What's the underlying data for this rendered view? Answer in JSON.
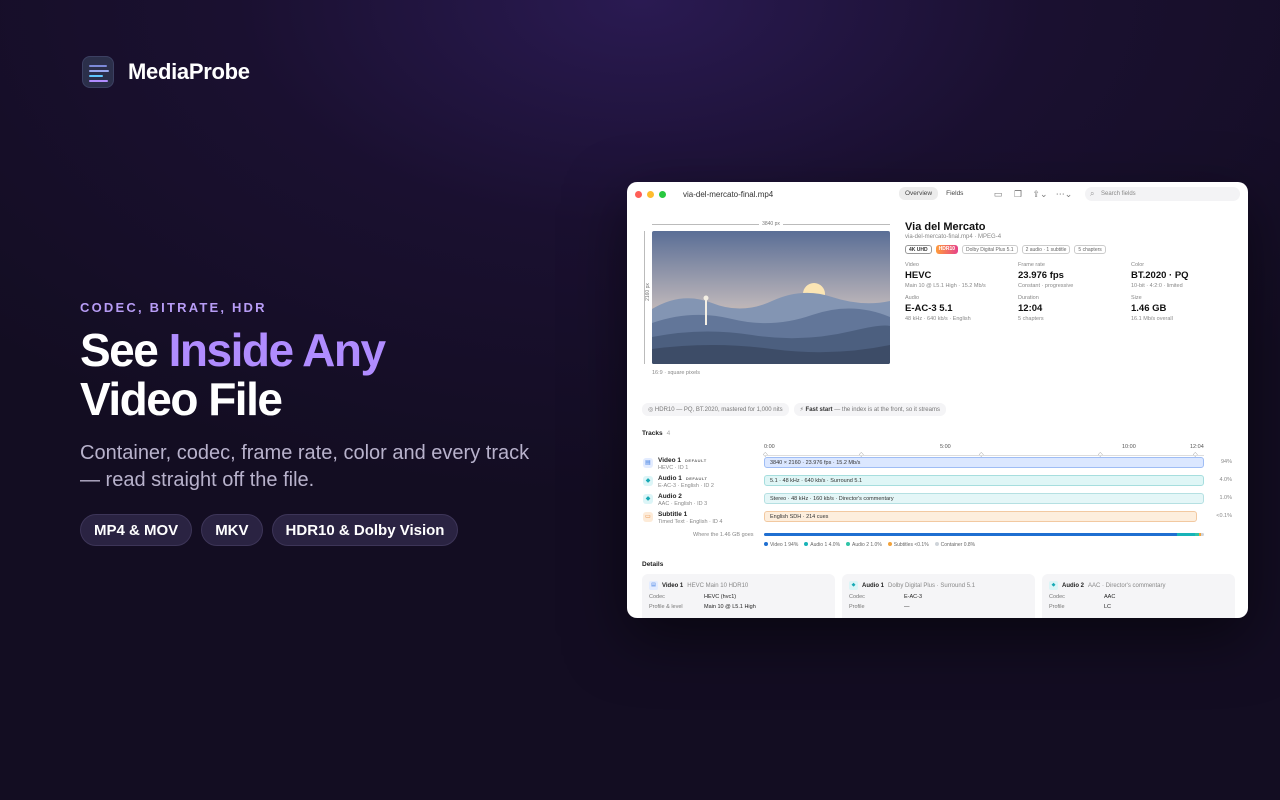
{
  "brand": {
    "name": "MediaProbe"
  },
  "hero": {
    "eyebrow": "CODEC, BITRATE, HDR",
    "headline_1": "See ",
    "headline_accent": "Inside Any",
    "headline_2": "Video File",
    "subtitle": "Container, codec, frame rate, color and every track — read straight off the file.",
    "pills": [
      "MP4 & MOV",
      "MKV",
      "HDR10 & Dolby Vision"
    ]
  },
  "window": {
    "filename": "via-del-mercato-final.mp4",
    "tabs": [
      {
        "label": "Overview",
        "active": true
      },
      {
        "label": "Fields",
        "active": false
      }
    ],
    "search_placeholder": "Search fields",
    "preview": {
      "width_label": "3840 px",
      "height_label": "2160 px",
      "aspect": "16:9 · square pixels"
    },
    "title": "Via del Mercato",
    "subtitle": "via-del-mercato-final.mp4 · MPEG-4",
    "badges": [
      "4K UHD",
      "HDR10",
      "Dolby Digital Plus 5.1",
      "2 audio · 1 subtitle",
      "5 chapters"
    ],
    "stats": [
      {
        "label": "Video",
        "value": "HEVC",
        "detail": "Main 10 @ L5.1 High · 15.2 Mb/s"
      },
      {
        "label": "Frame rate",
        "value": "23.976 fps",
        "detail": "Constant · progressive"
      },
      {
        "label": "Color",
        "value": "BT.2020 · PQ",
        "detail": "10-bit · 4:2:0 · limited"
      },
      {
        "label": "Audio",
        "value": "E-AC-3 5.1",
        "detail": "48 kHz · 640 kb/s · English"
      },
      {
        "label": "Duration",
        "value": "12:04",
        "detail": "5 chapters"
      },
      {
        "label": "Size",
        "value": "1.46 GB",
        "detail": "16.1 Mb/s overall"
      }
    ],
    "chips": [
      {
        "icon": "◎",
        "bold": "",
        "text": "HDR10 — PQ, BT.2020, mastered for 1,000 nits"
      },
      {
        "icon": "⚡",
        "bold": "Fast start",
        "text": " — the index is at the front, so it streams"
      }
    ],
    "tracks_label": "Tracks",
    "tracks_count": "4",
    "timeline": [
      "0:00",
      "5:00",
      "10:00",
      "12:04"
    ],
    "tracks": [
      {
        "name": "Video 1",
        "tag": "DEFAULT",
        "meta": "HEVC · ID 1",
        "bar": "3840 × 2160 · 23.976 fps · 15.2 Mb/s",
        "pct": "94%",
        "icon": "▤",
        "color": "#dbe7ff",
        "border": "#9fbdf5",
        "icolor": "#3b7be0",
        "ibg": "#e3ecff",
        "barwidth": 440
      },
      {
        "name": "Audio 1",
        "tag": "DEFAULT",
        "meta": "E-AC-3 · English · ID 2",
        "bar": "5.1 · 48 kHz · 640 kb/s · Surround 5.1",
        "pct": "4.0%",
        "icon": "◆",
        "color": "#dff6f6",
        "border": "#a6dede",
        "icolor": "#17a9b5",
        "ibg": "#dcf5f7",
        "barwidth": 440
      },
      {
        "name": "Audio 2",
        "tag": "",
        "meta": "AAC · English · ID 3",
        "bar": "Stereo · 48 kHz · 160 kb/s · Director's commentary",
        "pct": "1.0%",
        "icon": "◆",
        "color": "#e4f6f7",
        "border": "#b5e0e2",
        "icolor": "#17a9b5",
        "ibg": "#dcf5f7",
        "barwidth": 440
      },
      {
        "name": "Subtitle 1",
        "tag": "",
        "meta": "Timed Text · English · ID 4",
        "bar": "English SDH · 214 cues",
        "pct": "<0.1%",
        "icon": "▭",
        "color": "#fdeedd",
        "border": "#f2c9a1",
        "icolor": "#e6883a",
        "ibg": "#fdebd8",
        "barwidth": 433
      }
    ],
    "size_label": "Where the 1.46 GB goes",
    "size_breakdown": [
      {
        "label": "Video 1 94%",
        "value": 94,
        "color": "#1f6fd1"
      },
      {
        "label": "Audio 1 4.0%",
        "value": 4.0,
        "color": "#17b3b8"
      },
      {
        "label": "Audio 2 1.0%",
        "value": 1.0,
        "color": "#2ec4a7"
      },
      {
        "label": "Subtitles <0.1%",
        "value": 0.3,
        "color": "#f2a23a"
      },
      {
        "label": "Container 0.8%",
        "value": 0.8,
        "color": "#cfd4da"
      }
    ],
    "details_label": "Details",
    "details": [
      {
        "name": "Video 1",
        "desc": "HEVC Main 10 HDR10",
        "icon": "▤",
        "icolor": "#3b7be0",
        "ibg": "#e3ecff",
        "rows": [
          {
            "k": "Codec",
            "v": "HEVC (hvc1)"
          },
          {
            "k": "Profile & level",
            "v": "Main 10 @ L5.1 High"
          }
        ]
      },
      {
        "name": "Audio 1",
        "desc": "Dolby Digital Plus · Surround 5.1",
        "icon": "◆",
        "icolor": "#17a9b5",
        "ibg": "#dcf5f7",
        "rows": [
          {
            "k": "Codec",
            "v": "E-AC-3"
          },
          {
            "k": "Profile",
            "v": "—"
          }
        ]
      },
      {
        "name": "Audio 2",
        "desc": "AAC · Director's commentary",
        "icon": "◆",
        "icolor": "#17a9b5",
        "ibg": "#dcf5f7",
        "rows": [
          {
            "k": "Codec",
            "v": "AAC"
          },
          {
            "k": "Profile",
            "v": "LC"
          }
        ]
      }
    ]
  }
}
